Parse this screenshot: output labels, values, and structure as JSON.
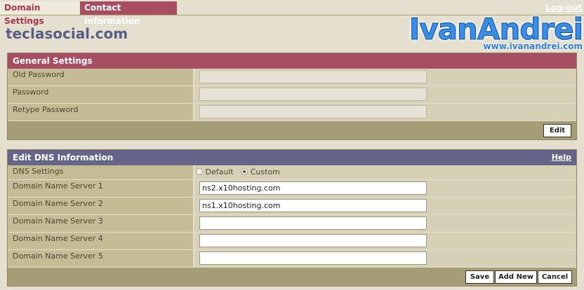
{
  "tabs": {
    "domain_settings": "Domain Settings",
    "contact_information": "Contact Information",
    "logout": "Log-out"
  },
  "site_title": "teclasocial.com",
  "logo": {
    "name": "IvanAndrei",
    "url": "www.ivanandrei.com"
  },
  "general": {
    "title": "General Settings",
    "rows": [
      {
        "label": "Old Password",
        "value": ""
      },
      {
        "label": "Password",
        "value": ""
      },
      {
        "label": "Retype Password",
        "value": ""
      }
    ],
    "edit_button": "Edit"
  },
  "dns": {
    "title": "Edit DNS Information",
    "help": "Help",
    "settings_label": "DNS Settings",
    "option_default": "Default",
    "option_custom": "Custom",
    "selected": "Custom",
    "servers": [
      {
        "label": "Domain Name Server 1",
        "value": "ns2.x10hosting.com"
      },
      {
        "label": "Domain Name Server 2",
        "value": "ns1.x10hosting.com"
      },
      {
        "label": "Domain Name Server 3",
        "value": ""
      },
      {
        "label": "Domain Name Server 4",
        "value": ""
      },
      {
        "label": "Domain Name Server 5",
        "value": ""
      }
    ],
    "save_button": "Save",
    "add_new_button": "Add New",
    "cancel_button": "Cancel"
  },
  "colors": {
    "tab_active": "#a84e63",
    "general_header": "#a84e63",
    "dns_header": "#65658a",
    "site_title": "#5a5d86",
    "logo_blue": "#3a8ee6"
  }
}
